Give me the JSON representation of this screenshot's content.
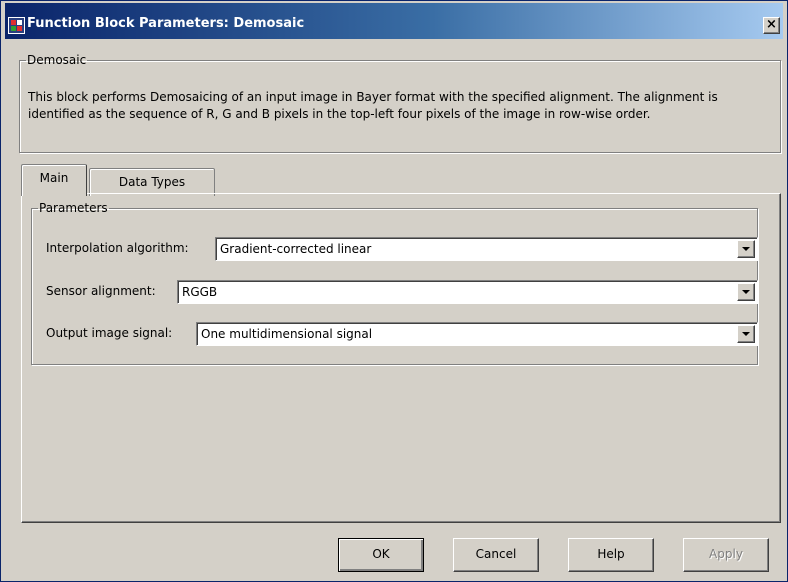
{
  "window": {
    "title": "Function Block Parameters: Demosaic",
    "close_glyph": "×"
  },
  "description": {
    "group_label": "Demosaic",
    "text": "This block performs Demosaicing of an input image in Bayer format with the specified alignment. The alignment is identified as the sequence of R, G and B pixels in the top-left four pixels of the image in row-wise order."
  },
  "tabs": [
    {
      "label": "Main",
      "active": true
    },
    {
      "label": "Data Types",
      "active": false
    }
  ],
  "parameters": {
    "group_label": "Parameters",
    "fields": [
      {
        "label": "Interpolation algorithm:",
        "value": "Gradient-corrected linear"
      },
      {
        "label": "Sensor alignment:",
        "value": "RGGB"
      },
      {
        "label": "Output image signal:",
        "value": "One multidimensional signal"
      }
    ]
  },
  "buttons": {
    "ok": "OK",
    "cancel": "Cancel",
    "help": "Help",
    "apply": "Apply"
  },
  "colors": {
    "titlebar_start": "#0a246a",
    "titlebar_end": "#a6caf0",
    "dialog_bg": "#d4d0c8"
  }
}
